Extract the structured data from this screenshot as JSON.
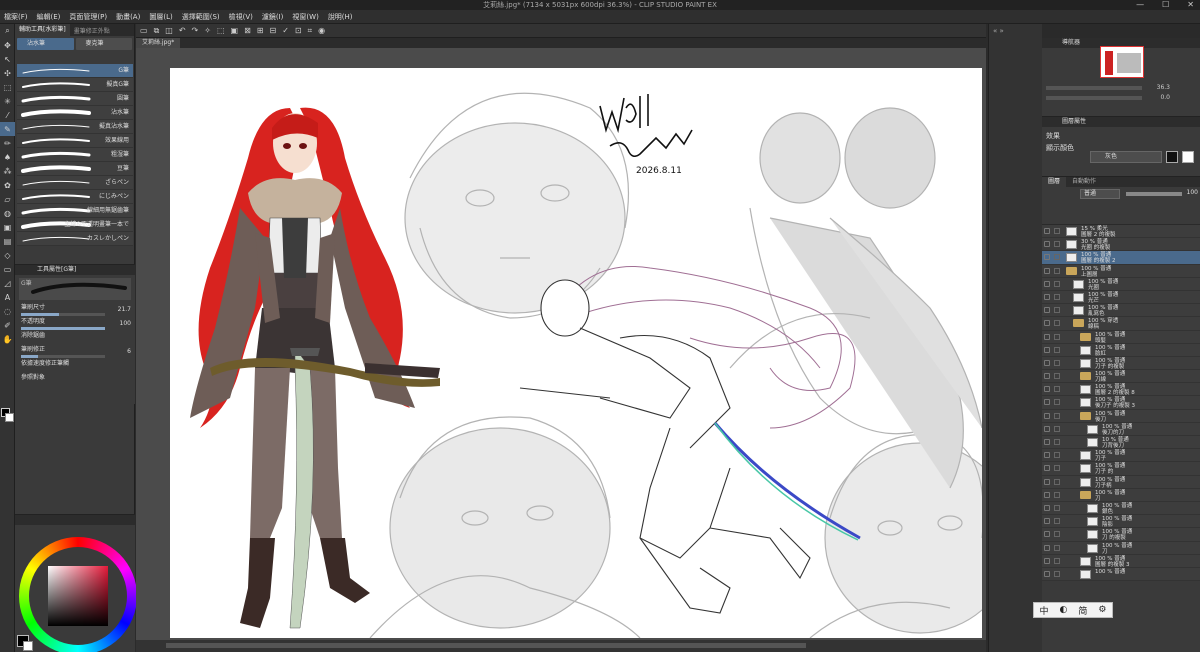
{
  "window": {
    "title": "艾莉絲.jpg* (7134 x 5031px 600dpi 36.3%) - CLIP STUDIO PAINT EX",
    "controls": [
      "—",
      "☐",
      "✕"
    ]
  },
  "menu": [
    "檔案(F)",
    "編輯(E)",
    "頁面管理(P)",
    "動畫(A)",
    "圖層(L)",
    "選擇範圍(S)",
    "檢視(V)",
    "濾鏡(I)",
    "視窗(W)",
    "說明(H)"
  ],
  "subtool": {
    "tabs": [
      "輔助工具[水彩筆]",
      "畫筆修正外點"
    ],
    "groups": [
      "沾水筆",
      "麥克筆"
    ],
    "brushes": [
      "G筆",
      "擬真G筆",
      "圓筆",
      "沾水筆",
      "擬真沾水筆",
      "效果線用",
      "粗湿筆",
      "豆筆",
      "ざらペン",
      "にじみペン",
      "線細用無鋸齒筆",
      "主線&不透明畫筆一本で",
      "カスレかしペン"
    ],
    "selected_index": 0
  },
  "tool_property": {
    "title": "工具屬性[G筆]",
    "preview_label": "G筆",
    "rows": [
      {
        "label": "筆刷尺寸",
        "value": "21.7",
        "fraction": 0.45
      },
      {
        "label": "不透明度",
        "value": "100",
        "fraction": 1.0
      },
      {
        "label": "消除鋸齒",
        "value": "",
        "fraction": 0
      },
      {
        "label": "筆刷修正",
        "value": "6",
        "fraction": 0.2
      },
      {
        "label": "依據速度修正筆觸",
        "value": "",
        "fraction": 0
      },
      {
        "label": "參照對象",
        "value": "",
        "fraction": 0
      }
    ]
  },
  "document": {
    "tab_label": "艾莉絲.jpg*",
    "signature_text": "Wall Strange",
    "signature_date": "2026.8.11"
  },
  "navigator": {
    "title": "導航器",
    "zoom": "36.3",
    "rotation": "0.0"
  },
  "color_set": {
    "title": "圖層屬性",
    "effect_label": "效果",
    "color_label": "顯示顏色",
    "color_value": "灰色"
  },
  "layer_panel": {
    "tabs": [
      "圖層",
      "自動動作"
    ],
    "blend_mode": "普通",
    "opacity": "100",
    "layers": [
      {
        "name": "15 % 柔光\n圖層 2 的複製",
        "depth": 0,
        "kind": "layer",
        "selected": false
      },
      {
        "name": "30 % 普通\n光圈 的複製",
        "depth": 0,
        "kind": "layer",
        "selected": false
      },
      {
        "name": "100 % 普通\n圖層 的複製 2",
        "depth": 0,
        "kind": "layer",
        "selected": true
      },
      {
        "name": "100 % 普通\n上圖層",
        "depth": 0,
        "kind": "folder",
        "selected": false
      },
      {
        "name": "100 % 普通\n光圈",
        "depth": 1,
        "kind": "layer",
        "selected": false
      },
      {
        "name": "100 % 普通\n光芒",
        "depth": 1,
        "kind": "layer",
        "selected": false
      },
      {
        "name": "100 % 普通\n亂寫色",
        "depth": 1,
        "kind": "layer",
        "selected": false
      },
      {
        "name": "100 % 穿透\n線稿",
        "depth": 1,
        "kind": "folder",
        "selected": false
      },
      {
        "name": "100 % 普通\n頭髮",
        "depth": 2,
        "kind": "folder",
        "selected": false
      },
      {
        "name": "100 % 普通\n臉紅",
        "depth": 2,
        "kind": "layer",
        "selected": false
      },
      {
        "name": "100 % 普通\n刀子 的複製",
        "depth": 2,
        "kind": "layer",
        "selected": false
      },
      {
        "name": "100 % 普通\n刀線",
        "depth": 2,
        "kind": "folder",
        "selected": false
      },
      {
        "name": "100 % 普通\n圖層 2 的複製 8",
        "depth": 2,
        "kind": "layer",
        "selected": false
      },
      {
        "name": "100 % 普通\n後刀子 的複製 3",
        "depth": 2,
        "kind": "layer",
        "selected": false
      },
      {
        "name": "100 % 普通\n後刀",
        "depth": 2,
        "kind": "folder",
        "selected": false
      },
      {
        "name": "100 % 普通\n後刀的刀",
        "depth": 3,
        "kind": "layer",
        "selected": false
      },
      {
        "name": "10 % 普通\n刀背後刀",
        "depth": 3,
        "kind": "layer",
        "selected": false
      },
      {
        "name": "100 % 普通\n刀子",
        "depth": 2,
        "kind": "layer",
        "selected": false
      },
      {
        "name": "100 % 普通\n刀子 的",
        "depth": 2,
        "kind": "layer",
        "selected": false
      },
      {
        "name": "100 % 普通\n刀子柄",
        "depth": 2,
        "kind": "layer",
        "selected": false
      },
      {
        "name": "100 % 普通\n刀",
        "depth": 2,
        "kind": "folder",
        "selected": false
      },
      {
        "name": "100 % 普通\n銀色",
        "depth": 3,
        "kind": "layer",
        "selected": false
      },
      {
        "name": "100 % 普通\n陰影",
        "depth": 3,
        "kind": "layer",
        "selected": false
      },
      {
        "name": "100 % 普通\n刀 的複製",
        "depth": 3,
        "kind": "layer",
        "selected": false
      },
      {
        "name": "100 % 普通\n刀",
        "depth": 3,
        "kind": "layer",
        "selected": false
      },
      {
        "name": "100 % 普通\n圖層 的複製 3",
        "depth": 2,
        "kind": "layer",
        "selected": false
      },
      {
        "name": "100 % 普通\n",
        "depth": 2,
        "kind": "layer",
        "selected": false
      }
    ]
  },
  "ime": [
    "中",
    "◐",
    "简",
    "⚙"
  ],
  "colors": {
    "accent": "#4a6a8c",
    "panel": "#3a3a3a",
    "hair": "#d8231f"
  }
}
